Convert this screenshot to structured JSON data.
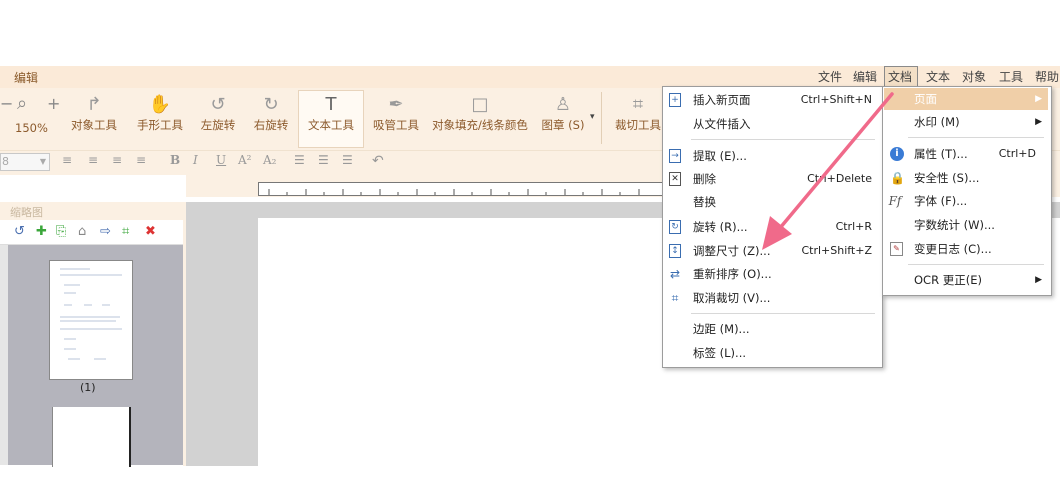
{
  "app": {
    "title": "编辑"
  },
  "menubar": [
    "文件",
    "编辑",
    "文档",
    "文本",
    "对象",
    "工具",
    "帮助"
  ],
  "zoom": {
    "minus": "−",
    "plus": "+",
    "value": "150%"
  },
  "toolbar": [
    {
      "label": "对象工具",
      "icon": "cursor-icon"
    },
    {
      "label": "手形工具",
      "icon": "hand-icon"
    },
    {
      "label": "左旋转",
      "icon": "rotate-left-icon"
    },
    {
      "label": "右旋转",
      "icon": "rotate-right-icon"
    },
    {
      "label": "文本工具",
      "icon": "text-tool-icon"
    },
    {
      "label": "吸管工具",
      "icon": "eyedropper-icon"
    },
    {
      "label": "对象填充/线条颜色",
      "icon": "fill-color-icon"
    },
    {
      "label": "图章 (S)",
      "icon": "stamp-icon"
    },
    {
      "label": "裁切工具",
      "icon": "crop-icon"
    }
  ],
  "format": {
    "font_size": "8",
    "bold": "B",
    "italic": "I",
    "underline": "U",
    "superscript": "A²",
    "subscript": "A₂"
  },
  "side_panel": {
    "title": "缩略图",
    "page_label": "(1)"
  },
  "main_menu": {
    "items": [
      {
        "label": "插入新页面",
        "shortcut": "Ctrl+Shift+N",
        "icon": "insert-page-icon"
      },
      {
        "label": "从文件插入",
        "shortcut": "",
        "icon": ""
      },
      {
        "label": "提取 (E)...",
        "shortcut": "",
        "icon": "extract-icon"
      },
      {
        "label": "删除",
        "shortcut": "Ctrl+Delete",
        "icon": "delete-page-icon"
      },
      {
        "label": "替换",
        "shortcut": "",
        "icon": ""
      },
      {
        "label": "旋转 (R)...",
        "shortcut": "Ctrl+R",
        "icon": "rotate-page-icon"
      },
      {
        "label": "调整尺寸 (Z)...",
        "shortcut": "Ctrl+Shift+Z",
        "icon": "resize-icon"
      },
      {
        "label": "重新排序 (O)...",
        "shortcut": "",
        "icon": "reorder-icon"
      },
      {
        "label": "取消裁切 (V)...",
        "shortcut": "",
        "icon": "uncrop-icon"
      },
      {
        "label": "边距 (M)...",
        "shortcut": "",
        "icon": ""
      },
      {
        "label": "标签 (L)...",
        "shortcut": "",
        "icon": ""
      }
    ]
  },
  "sub_menu": {
    "items": [
      {
        "label": "页面",
        "shortcut": "",
        "icon": ""
      },
      {
        "label": "水印 (M)",
        "shortcut": "",
        "icon": ""
      },
      {
        "label": "属性 (T)...",
        "shortcut": "Ctrl+D",
        "icon": "info-icon"
      },
      {
        "label": "安全性 (S)...",
        "shortcut": "",
        "icon": "lock-icon"
      },
      {
        "label": "字体 (F)...",
        "shortcut": "",
        "icon": "font-icon"
      },
      {
        "label": "字数统计 (W)...",
        "shortcut": "",
        "icon": ""
      },
      {
        "label": "变更日志 (C)...",
        "shortcut": "",
        "icon": "changelog-icon"
      },
      {
        "label": "OCR 更正(E)",
        "shortcut": "",
        "icon": ""
      }
    ]
  },
  "colors": {
    "accent": "#f0cfa8",
    "ribbon": "#fbf0e3",
    "arrow": "#f06a8a",
    "label": "#8c5a2c"
  }
}
